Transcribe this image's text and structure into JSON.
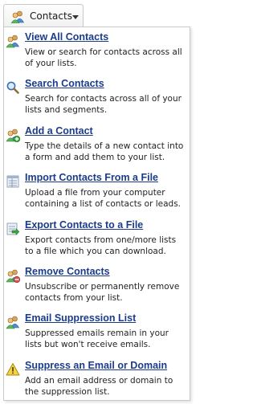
{
  "button": {
    "label": "Contacts",
    "icon": "contacts-group-icon"
  },
  "menu": {
    "items": [
      {
        "title": "View All Contacts",
        "description": "View or search for contacts across all of your lists.",
        "icon": "contacts-group-icon"
      },
      {
        "title": "Search Contacts",
        "description": "Search for contacts across all of your lists and segments.",
        "icon": "magnifier-icon"
      },
      {
        "title": "Add a Contact",
        "description": "Type the details of a new contact into a form and add them to your list.",
        "icon": "add-contact-icon"
      },
      {
        "title": "Import Contacts From a File",
        "description": "Upload a file from your computer containing a list of contacts or leads.",
        "icon": "import-file-icon"
      },
      {
        "title": "Export Contacts to a File",
        "description": "Export contacts from one/more lists to a file which you can download.",
        "icon": "export-file-icon"
      },
      {
        "title": "Remove Contacts",
        "description": "Unsubscribe or permanently remove contacts from your list.",
        "icon": "remove-contact-icon"
      },
      {
        "title": "Email Suppression List",
        "description": "Suppressed emails remain in your lists but won't receive emails.",
        "icon": "suppression-list-icon"
      },
      {
        "title": "Suppress an Email or Domain",
        "description": "Add an email address or domain to the suppression list.",
        "icon": "warning-icon"
      }
    ]
  }
}
